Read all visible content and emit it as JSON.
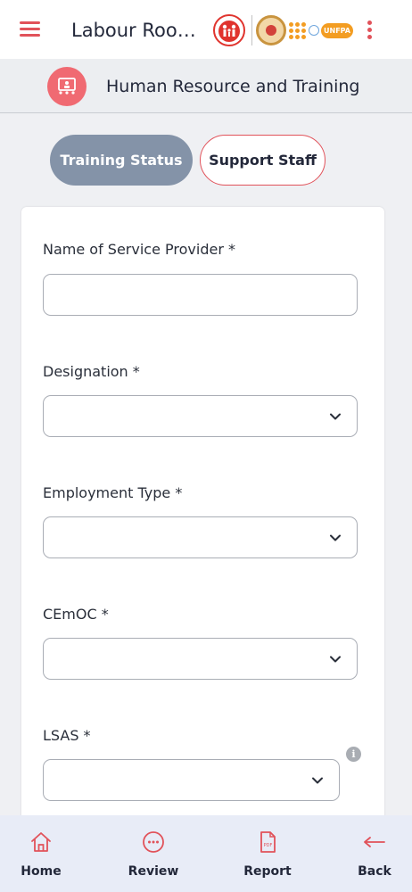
{
  "app_bar": {
    "title": "Labour Roo…",
    "logo_unfpa_text": "UNFPA"
  },
  "section": {
    "title": "Human Resource and Training"
  },
  "tabs": [
    {
      "label": "Training Status",
      "active": true
    },
    {
      "label": "Support Staff",
      "active": false
    }
  ],
  "form": {
    "fields": [
      {
        "label": "Name of Service Provider *",
        "type": "text",
        "value": ""
      },
      {
        "label": "Designation *",
        "type": "select",
        "value": ""
      },
      {
        "label": "Employment Type *",
        "type": "select",
        "value": ""
      },
      {
        "label": "CEmOC *",
        "type": "select",
        "value": ""
      },
      {
        "label": "LSAS *",
        "type": "select",
        "value": ""
      }
    ],
    "info_glyph": "i"
  },
  "bottom_nav": [
    {
      "label": "Home",
      "icon": "home-icon"
    },
    {
      "label": "Review",
      "icon": "review-icon"
    },
    {
      "label": "Report",
      "icon": "pdf-report-icon"
    },
    {
      "label": "Back",
      "icon": "back-arrow-icon"
    }
  ],
  "colors": {
    "accent": "#e1525a",
    "tab_active_bg": "#8493a8",
    "bottom_nav_bg": "#e8ecf7",
    "page_bg": "#eff0f3"
  }
}
